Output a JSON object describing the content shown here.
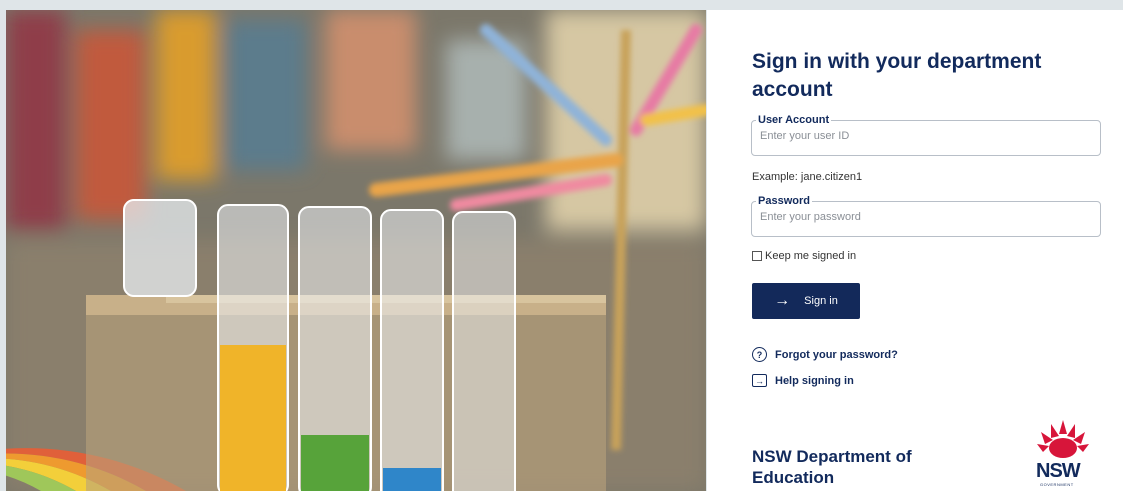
{
  "login": {
    "title": "Sign in with your department account",
    "user_account_label": "User Account",
    "user_account_placeholder": "Enter your user ID",
    "user_account_example": "Example: jane.citizen1",
    "password_label": "Password",
    "password_placeholder": "Enter your password",
    "keep_signed_in_label": "Keep me signed in",
    "sign_in_label": "Sign in",
    "forgot_password_label": "Forgot your password?",
    "help_label": "Help signing in"
  },
  "footer": {
    "org_name": "NSW Department of Education",
    "logo_text": "NSW",
    "logo_subtext": "GOVERNMENT"
  },
  "icons": {
    "sign_in": "arrow-right-icon",
    "forgot": "question-circle-icon",
    "help": "exit-box-icon",
    "logo": "waratah-icon"
  },
  "colors": {
    "brand_navy": "#122a5c",
    "button_bg": "#13295a",
    "logo_red": "#d7153a"
  }
}
